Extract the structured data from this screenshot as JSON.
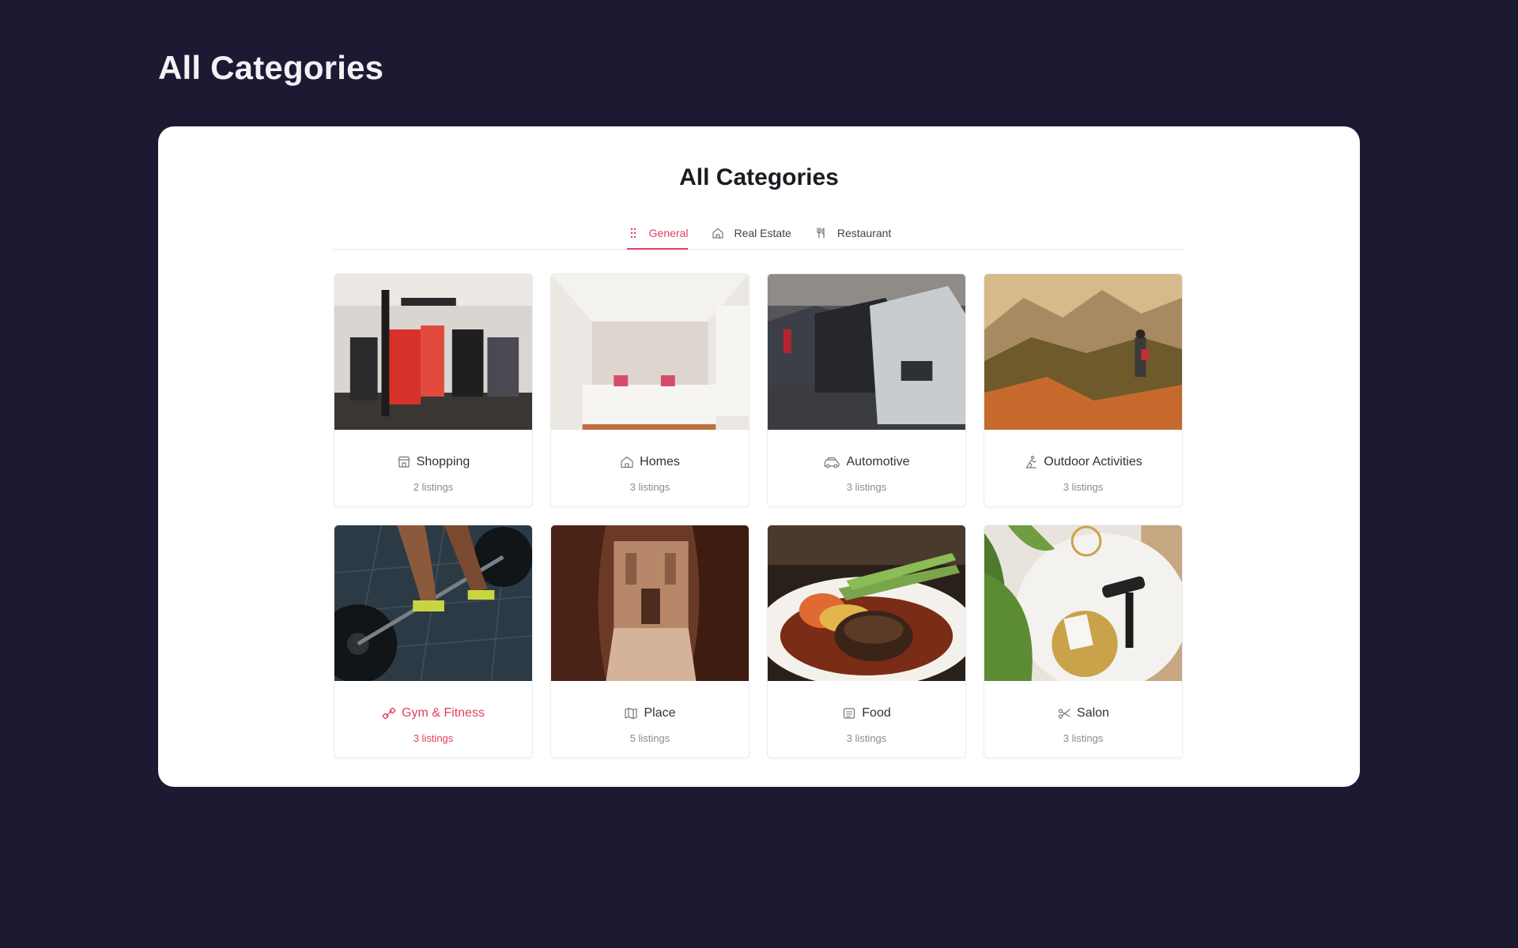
{
  "page": {
    "heading": "All Categories"
  },
  "panel": {
    "title": "All Categories"
  },
  "tabs": [
    {
      "label": "General",
      "icon": "dots-grid-icon",
      "active": true
    },
    {
      "label": "Real Estate",
      "icon": "house-icon",
      "active": false
    },
    {
      "label": "Restaurant",
      "icon": "fork-knife-icon",
      "active": false
    }
  ],
  "categories": [
    {
      "title": "Shopping",
      "count": "2 listings",
      "icon": "store-icon"
    },
    {
      "title": "Homes",
      "count": "3 listings",
      "icon": "house-icon"
    },
    {
      "title": "Automotive",
      "count": "3 listings",
      "icon": "car-icon"
    },
    {
      "title": "Outdoor Activities",
      "count": "3 listings",
      "icon": "hiker-icon"
    },
    {
      "title": "Gym & Fitness",
      "count": "3 listings",
      "icon": "dumbbell-icon",
      "highlight": true
    },
    {
      "title": "Place",
      "count": "5 listings",
      "icon": "map-icon"
    },
    {
      "title": "Food",
      "count": "3 listings",
      "icon": "menu-icon"
    },
    {
      "title": "Salon",
      "count": "3 listings",
      "icon": "scissors-icon"
    }
  ],
  "colors": {
    "background": "#1c1a33",
    "panel": "#ffffff",
    "accent": "#e0405e",
    "muted": "#8a8a95"
  }
}
